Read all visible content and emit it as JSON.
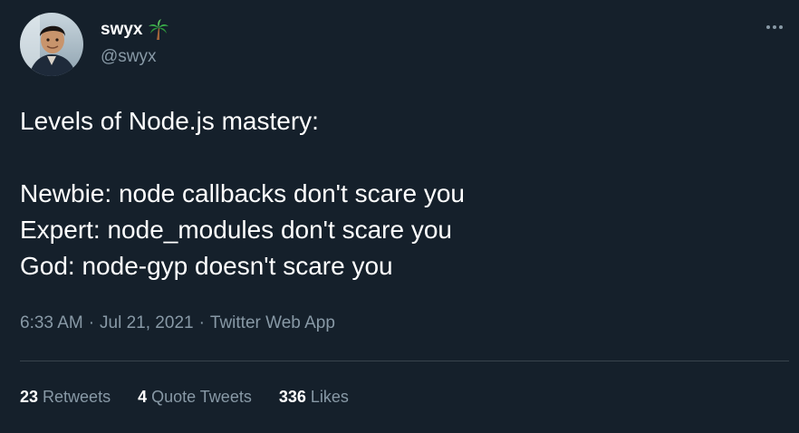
{
  "author": {
    "display_name": "swyx",
    "name_emoji": "palm-tree-icon",
    "handle": "@swyx"
  },
  "tweet": {
    "lines": [
      "Levels of Node.js mastery:",
      "",
      "Newbie: node callbacks don't scare you",
      "Expert: node_modules don't scare you",
      "God: node-gyp doesn't scare you"
    ]
  },
  "meta": {
    "time": "6:33 AM",
    "separator": "·",
    "date": "Jul 21, 2021",
    "source": "Twitter Web App"
  },
  "stats": {
    "retweets_count": "23",
    "retweets_label": "Retweets",
    "quotes_count": "4",
    "quotes_label": "Quote Tweets",
    "likes_count": "336",
    "likes_label": "Likes"
  },
  "colors": {
    "background": "#15202b",
    "text_primary": "#ffffff",
    "text_secondary": "#8899a6",
    "divider": "#38444d"
  }
}
